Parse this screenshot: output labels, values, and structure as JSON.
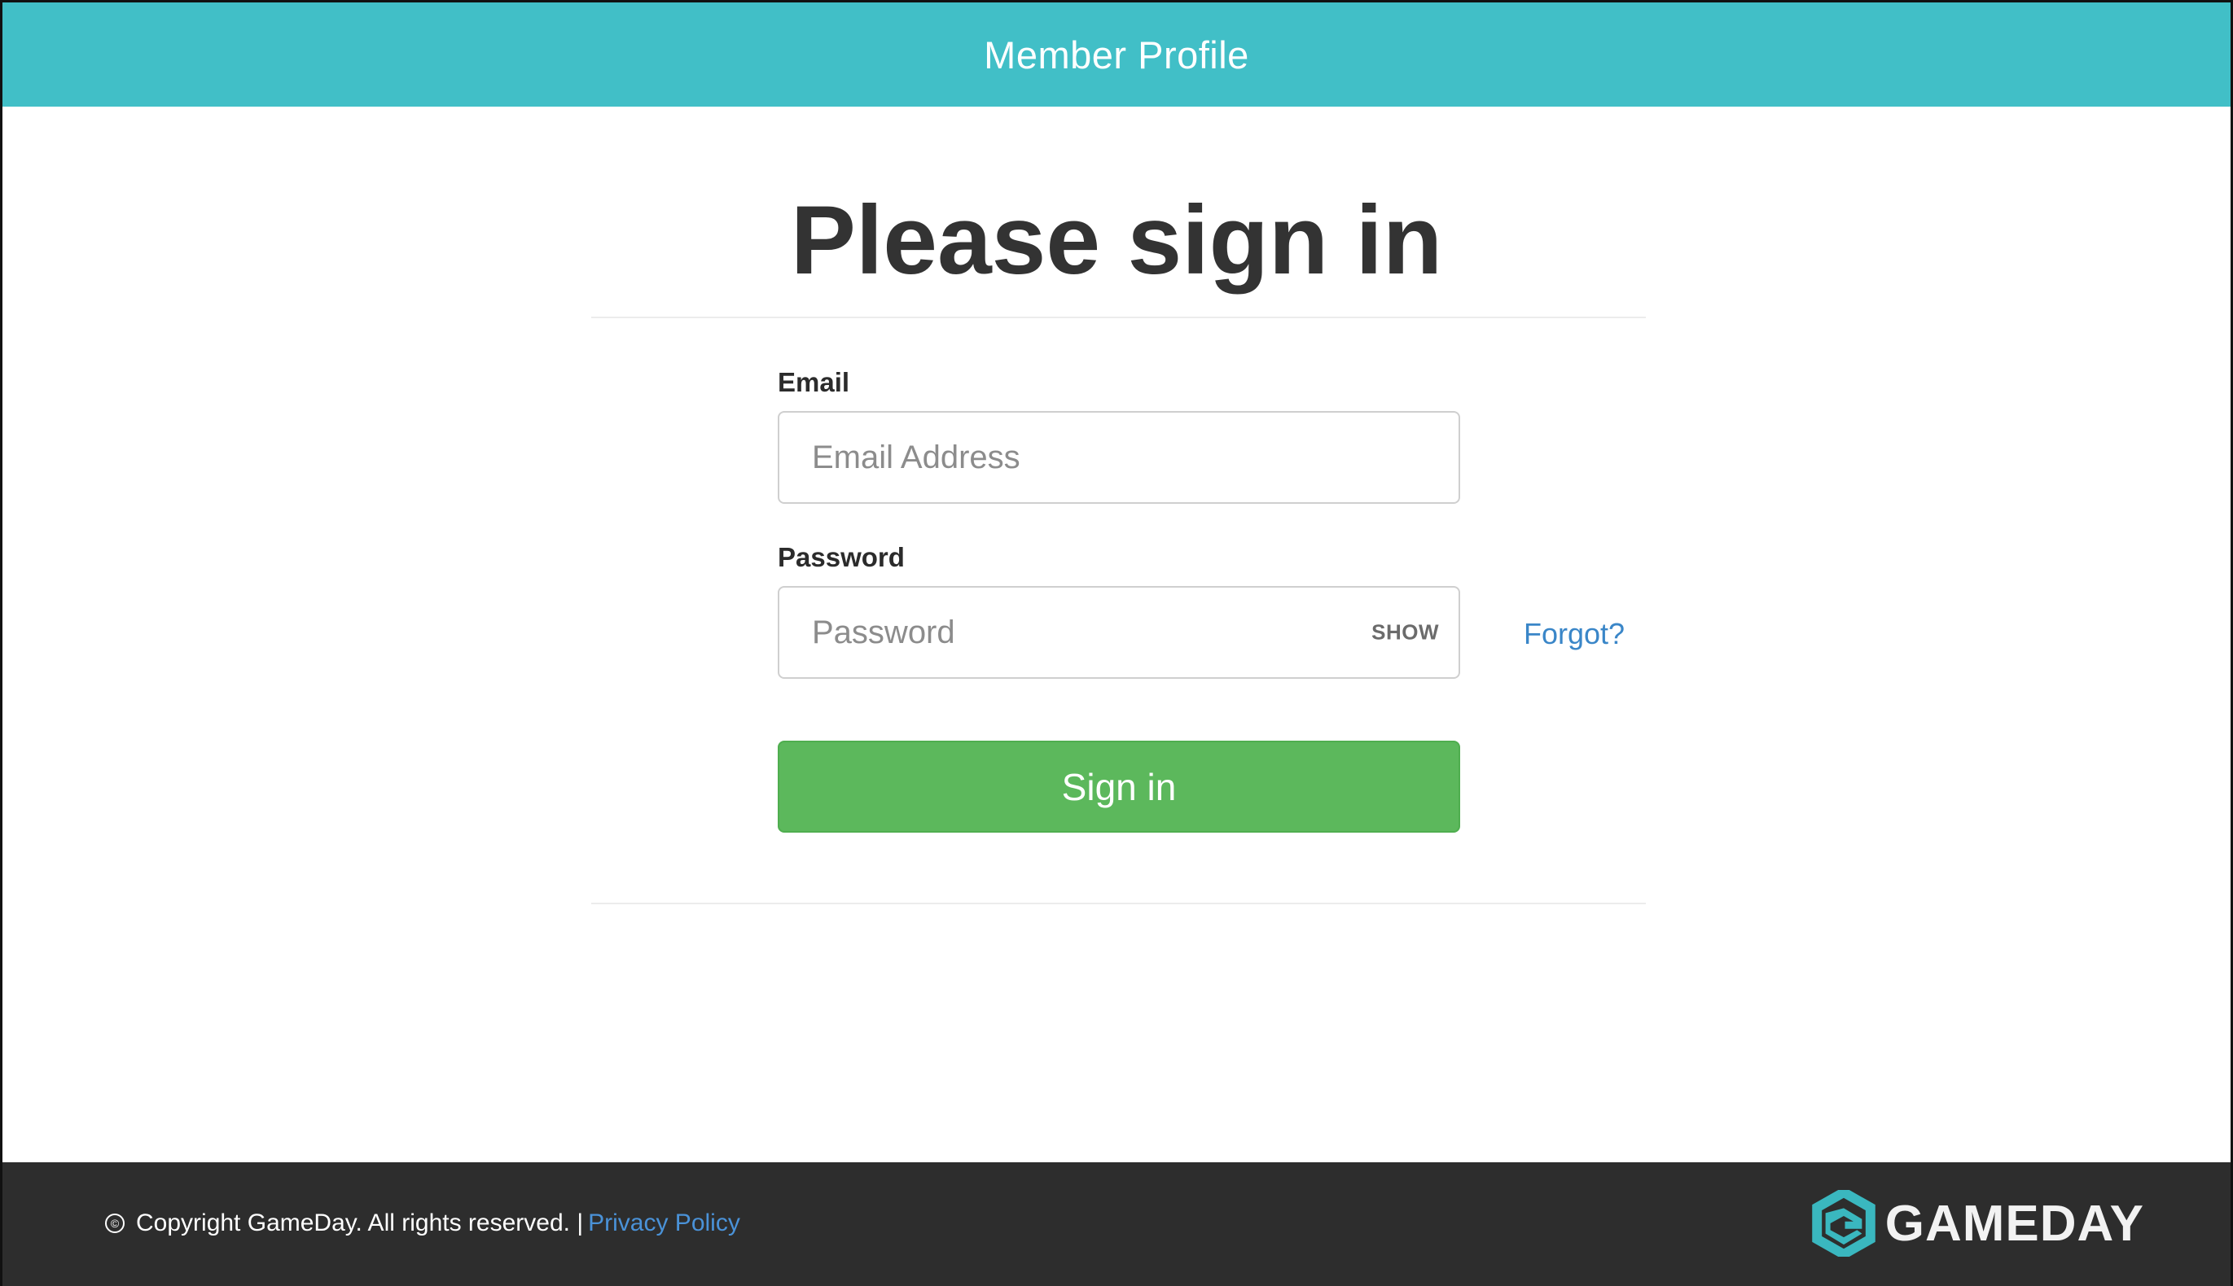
{
  "header": {
    "title": "Member Profile"
  },
  "main": {
    "heading": "Please sign in",
    "email": {
      "label": "Email",
      "placeholder": "Email Address",
      "value": ""
    },
    "password": {
      "label": "Password",
      "placeholder": "Password",
      "value": "",
      "toggle_label": "SHOW"
    },
    "forgot_label": "Forgot?",
    "submit_label": "Sign in"
  },
  "footer": {
    "copyright_symbol": "©",
    "copyright_text": "Copyright GameDay. All rights reserved. |",
    "privacy_label": "Privacy Policy",
    "brand_name": "GAMEDAY",
    "brand_icon": "gameday-g-hexagon-logo"
  },
  "colors": {
    "header_bg": "#41bfc7",
    "submit_bg": "#5cb85c",
    "link": "#3a86c8",
    "footer_bg": "#2d2d2d",
    "brand_teal": "#3ab7bf"
  }
}
